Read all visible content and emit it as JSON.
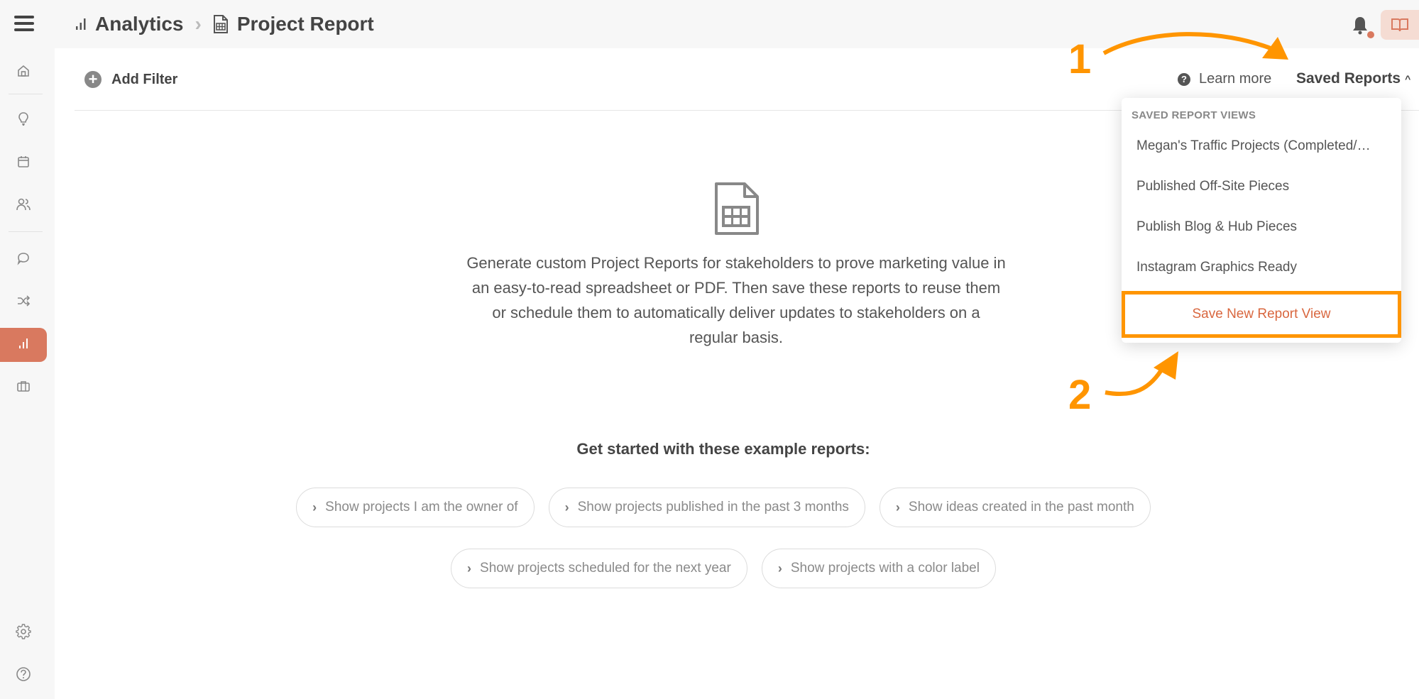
{
  "topbar": {
    "menu_icon": "hamburger-icon",
    "breadcrumb": [
      {
        "icon": "bar-chart-icon",
        "label": "Analytics"
      },
      {
        "icon": "spreadsheet-icon",
        "label": "Project Report"
      }
    ],
    "separator": "›",
    "notification_icon": "bell-icon",
    "guide_icon": "book-icon"
  },
  "sidebar": {
    "items": [
      {
        "name": "home",
        "icon": "home-icon"
      },
      {
        "name": "ideas",
        "icon": "lightbulb-icon"
      },
      {
        "name": "calendar",
        "icon": "calendar-icon"
      },
      {
        "name": "people",
        "icon": "users-icon"
      },
      {
        "name": "comments",
        "icon": "chat-icon"
      },
      {
        "name": "workflows",
        "icon": "shuffle-icon"
      },
      {
        "name": "analytics",
        "icon": "bar-chart-icon",
        "active": true
      },
      {
        "name": "portfolio",
        "icon": "briefcase-icon"
      }
    ],
    "bottom_items": [
      {
        "name": "settings",
        "icon": "gear-icon"
      },
      {
        "name": "help",
        "icon": "help-icon"
      }
    ],
    "active_color": "#d9795f"
  },
  "filterbar": {
    "add_filter_label": "Add Filter",
    "learn_more_label": "Learn more",
    "saved_reports_label": "Saved Reports",
    "saved_reports_caret": "^"
  },
  "empty_state": {
    "icon": "spreadsheet-icon",
    "description": "Generate custom Project Reports for stakeholders to prove marketing value in an easy-to-read spreadsheet or PDF. Then save these reports to reuse them or schedule them to automatically deliver updates to stakeholders on a regular basis.",
    "examples_title": "Get started with these example reports:",
    "examples_row1": [
      "Show projects I am the owner of",
      "Show projects published in the past 3 months",
      "Show ideas created in the past month"
    ],
    "examples_row2": [
      "Show projects scheduled for the next year",
      "Show projects with a color label"
    ]
  },
  "dropdown": {
    "header": "SAVED REPORT VIEWS",
    "items": [
      "Megan's Traffic Projects (Completed/…",
      "Published Off-Site Pieces",
      "Publish Blog & Hub Pieces",
      "Instagram Graphics Ready"
    ],
    "save_new_label": "Save New Report View",
    "save_new_color": "#d9673f"
  },
  "annotations": {
    "step1": "1",
    "step2": "2",
    "color": "#ff9500"
  }
}
